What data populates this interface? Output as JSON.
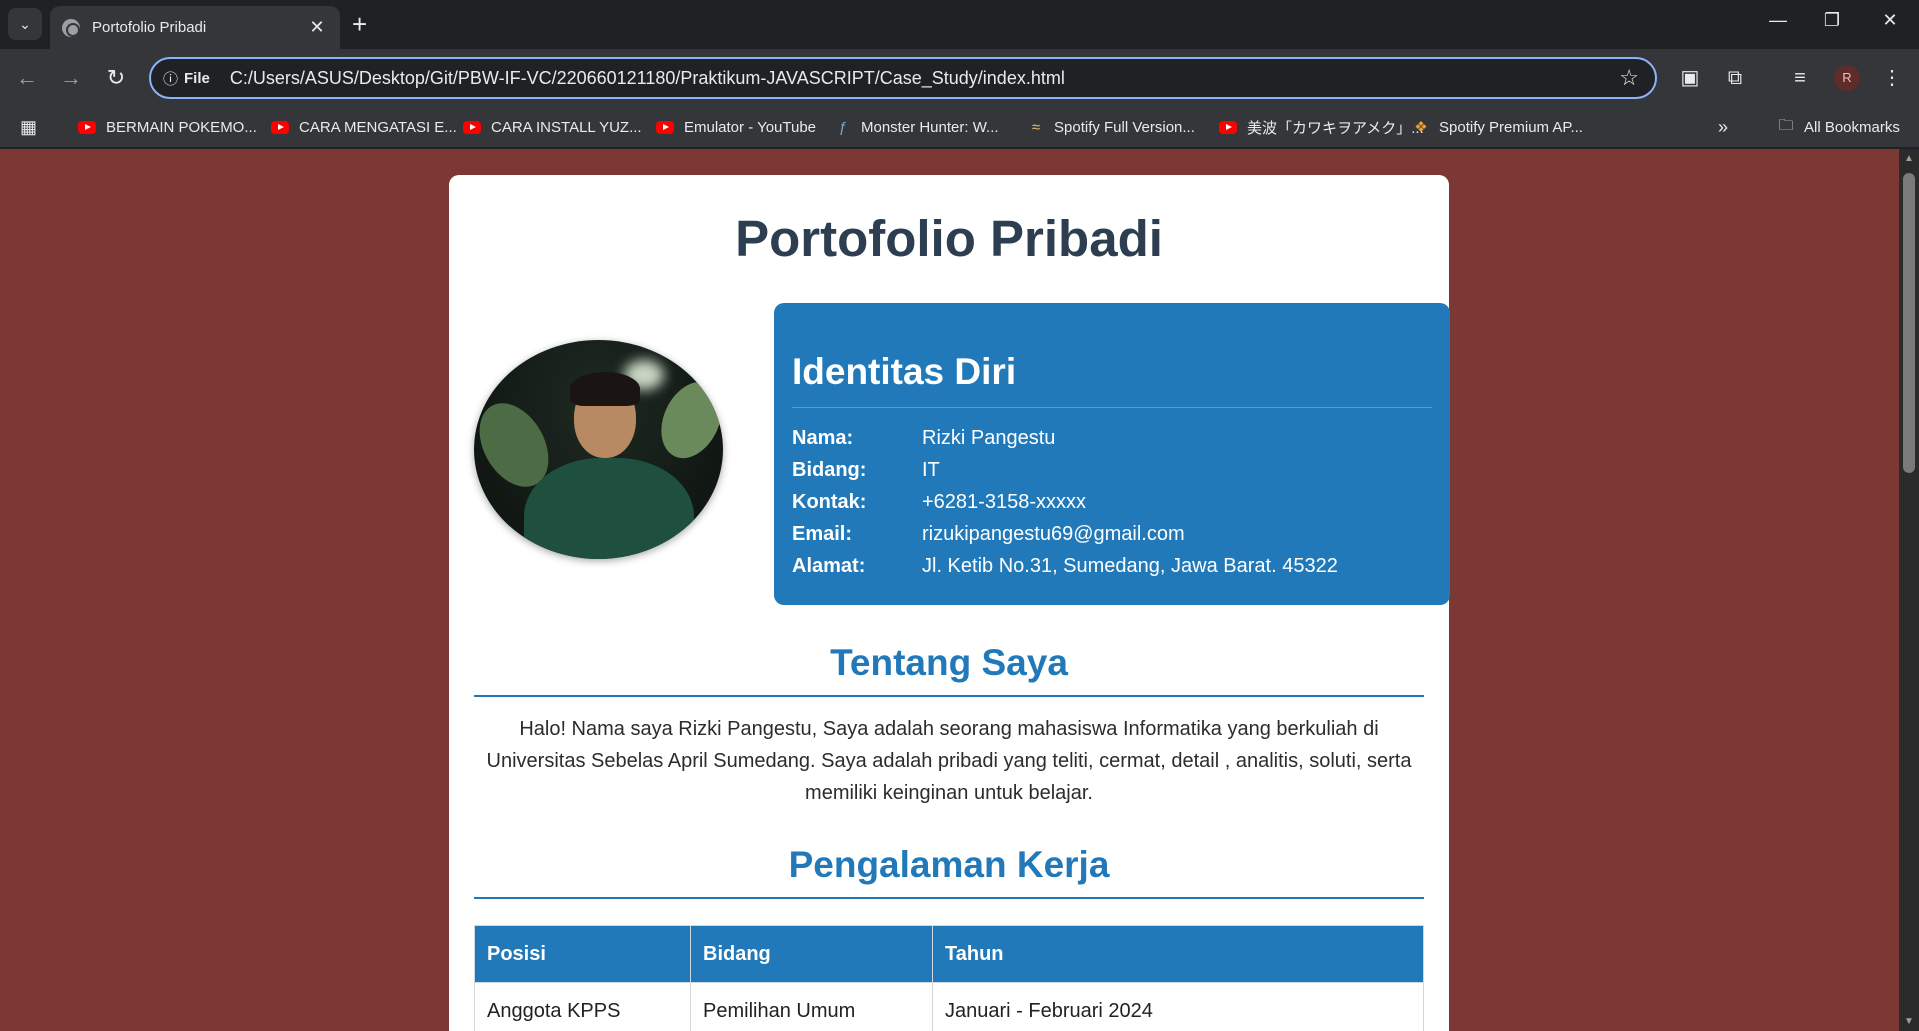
{
  "browser": {
    "tab_title": "Portofolio Pribadi",
    "new_tab": "+",
    "url_scheme": "File",
    "url": "C:/Users/ASUS/Desktop/Git/PBW-IF-VC/220660121180/Praktikum-JAVASCRIPT/Case_Study/index.html",
    "profile_initial": "R",
    "bookmarks": [
      {
        "label": "BERMAIN POKEMO...",
        "icon": "youtube-icon"
      },
      {
        "label": "CARA MENGATASI E...",
        "icon": "youtube-icon"
      },
      {
        "label": "CARA INSTALL YUZ...",
        "icon": "youtube-icon"
      },
      {
        "label": "Emulator - YouTube",
        "icon": "youtube-icon"
      },
      {
        "label": "Monster Hunter: W...",
        "icon": "monster-hunter-icon"
      },
      {
        "label": "Spotify Full Version...",
        "icon": "spotify-icon"
      },
      {
        "label": "美波「カワキヲアメク」...",
        "icon": "youtube-icon"
      },
      {
        "label": "Spotify Premium AP...",
        "icon": "spotify-premium-icon"
      }
    ],
    "all_bookmarks": "All Bookmarks"
  },
  "page": {
    "title": "Portofolio Pribadi",
    "identity": {
      "heading": "Identitas Diri",
      "rows": [
        {
          "key": "Nama:",
          "value": "Rizki Pangestu"
        },
        {
          "key": "Bidang:",
          "value": "IT"
        },
        {
          "key": "Kontak:",
          "value": "+6281-3158-xxxxx"
        },
        {
          "key": "Email:",
          "value": "rizukipangestu69@gmail.com"
        },
        {
          "key": "Alamat:",
          "value": "Jl. Ketib No.31, Sumedang, Jawa Barat. 45322"
        }
      ]
    },
    "about": {
      "heading": "Tentang Saya",
      "text": "Halo! Nama saya Rizki Pangestu, Saya adalah seorang mahasiswa Informatika yang berkuliah di Universitas Sebelas April Sumedang. Saya adalah pribadi yang teliti, cermat, detail , analitis, soluti, serta memiliki keinginan untuk belajar."
    },
    "experience": {
      "heading": "Pengalaman Kerja",
      "columns": [
        "Posisi",
        "Bidang",
        "Tahun"
      ],
      "rows": [
        [
          "Anggota KPPS",
          "Pemilihan Umum",
          "Januari - Februari 2024"
        ]
      ]
    }
  },
  "colors": {
    "page_background": "#7b3834",
    "accent": "#2179b9",
    "title_text": "#2c3e50"
  }
}
